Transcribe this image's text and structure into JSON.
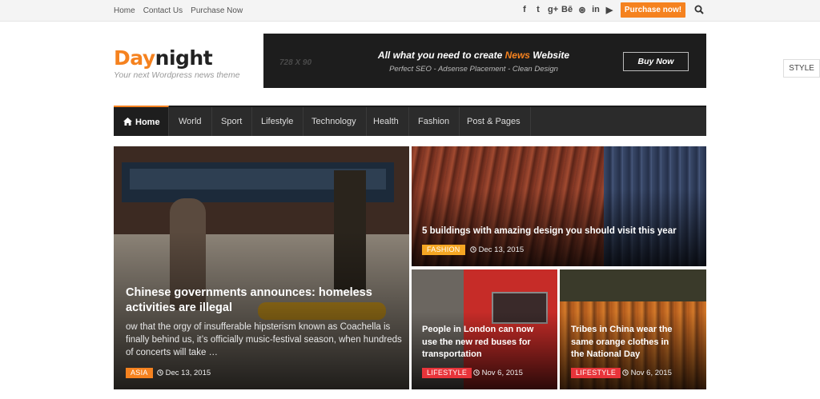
{
  "topbar": {
    "links": [
      "Home",
      "Contact Us",
      "Purchase Now"
    ],
    "social_icons": [
      "facebook-icon",
      "twitter-icon",
      "google-plus-icon",
      "behance-icon",
      "dribbble-icon",
      "linkedin-icon",
      "youtube-icon"
    ],
    "social_glyphs": [
      "f",
      "t",
      "g+",
      "Bē",
      "⊛",
      "in",
      "▶"
    ],
    "purchase_label": "Purchase now!"
  },
  "brand": {
    "logo_day": "Day",
    "logo_night": "night",
    "tagline": "Your next Wordpress news theme",
    "accent": "#f5821f"
  },
  "ad": {
    "size_label": "728 X 90",
    "headline_pre": "All what you need to create ",
    "headline_hl": "News",
    "headline_post": " Website",
    "subline": "Perfect SEO - Adsense Placement - Clean Design",
    "button": "Buy Now"
  },
  "style_button": "STYLE",
  "nav": {
    "items": [
      "Home",
      "World",
      "Sport",
      "Lifestyle",
      "Technology",
      "Health",
      "Fashion",
      "Post & Pages"
    ]
  },
  "featured": [
    {
      "title_l1": "Chinese governments announces: homeless",
      "title_l2": "activities are illegal",
      "excerpt_l1": "ow that the orgy of insufferable hipsterism known as Coachella is",
      "excerpt_l2": "finally behind us, it’s officially music-festival season, when hundreds",
      "excerpt_l3": "of concerts will take …",
      "category": "ASIA",
      "date": "Dec 13, 2015"
    },
    {
      "title_l1": "5 buildings with amazing design you should visit this year",
      "category": "FASHION",
      "date": "Dec 13, 2015"
    },
    {
      "title_l1": "People in London can now",
      "title_l2": "use the new red buses for",
      "title_l3": "transportation",
      "category": "LIFESTYLE",
      "date": "Nov 6, 2015"
    },
    {
      "title_l1": "Tribes in China wear the",
      "title_l2": "same orange clothes in",
      "title_l3": "the National Day",
      "category": "LIFESTYLE",
      "date": "Nov 6, 2015"
    }
  ]
}
